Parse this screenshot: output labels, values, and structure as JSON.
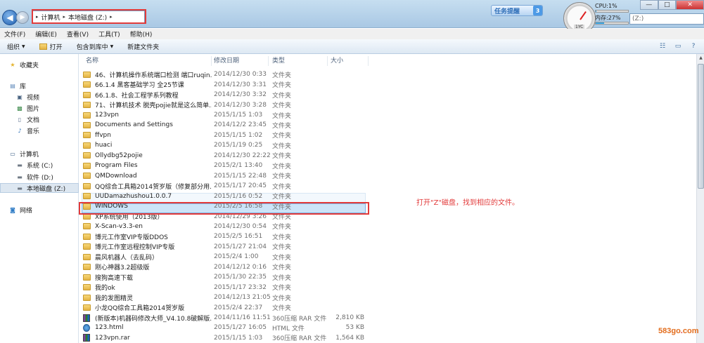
{
  "window": {
    "address": {
      "crumbs": [
        "计算机",
        "本地磁盘 (Z:)"
      ]
    },
    "search_placeholder": "(Z:)",
    "task_banner": {
      "label": "任务提醒",
      "count": "3"
    },
    "gauge_label": "1YC",
    "cpu": {
      "label": "CPU:1%",
      "percent": 1
    },
    "memory": {
      "label": "内存:27%",
      "percent": 27
    },
    "window_buttons": {
      "minimize": "—",
      "maximize": "□",
      "close": "✕"
    }
  },
  "menu": [
    "文件(F)",
    "编辑(E)",
    "查看(V)",
    "工具(T)",
    "帮助(H)"
  ],
  "toolbar": {
    "organize": "组织",
    "open": "打开",
    "include": "包含到库中",
    "new_folder": "新建文件夹"
  },
  "nav": {
    "favorites": "收藏夹",
    "libraries": "库",
    "lib_items": [
      "视频",
      "图片",
      "文档",
      "音乐"
    ],
    "computer": "计算机",
    "drives": [
      "系统 (C:)",
      "软件 (D:)",
      "本地磁盘 (Z:)"
    ],
    "network": "网络"
  },
  "columns": {
    "name": "名称",
    "date": "修改日期",
    "type": "类型",
    "size": "大小"
  },
  "files": [
    {
      "name": "46、计算机操作系统端口检测 端口ruqin...",
      "date": "2014/12/30 0:33",
      "type": "文件夹",
      "size": "",
      "kind": "folder"
    },
    {
      "name": "66.1.4 黑客基础学习 全25节课",
      "date": "2014/12/30 3:31",
      "type": "文件夹",
      "size": "",
      "kind": "folder"
    },
    {
      "name": "66.1.8、社会工程学系列教程",
      "date": "2014/12/30 3:32",
      "type": "文件夹",
      "size": "",
      "kind": "folder"
    },
    {
      "name": "71、计算机技术 脱壳pojie就是这么简单...",
      "date": "2014/12/30 3:28",
      "type": "文件夹",
      "size": "",
      "kind": "folder"
    },
    {
      "name": "123vpn",
      "date": "2015/1/15 1:03",
      "type": "文件夹",
      "size": "",
      "kind": "folder"
    },
    {
      "name": "Documents and Settings",
      "date": "2014/12/2 23:45",
      "type": "文件夹",
      "size": "",
      "kind": "folder"
    },
    {
      "name": "ffvpn",
      "date": "2015/1/15 1:02",
      "type": "文件夹",
      "size": "",
      "kind": "folder"
    },
    {
      "name": "huaci",
      "date": "2015/1/19 0:25",
      "type": "文件夹",
      "size": "",
      "kind": "folder"
    },
    {
      "name": "Ollydbg52pojie",
      "date": "2014/12/30 22:22",
      "type": "文件夹",
      "size": "",
      "kind": "folder"
    },
    {
      "name": "Program Files",
      "date": "2015/2/1 13:40",
      "type": "文件夹",
      "size": "",
      "kind": "folder"
    },
    {
      "name": "QMDownload",
      "date": "2015/1/15 22:48",
      "type": "文件夹",
      "size": "",
      "kind": "folder"
    },
    {
      "name": "QQ综合工具箱2014贺岁版（修复部分用...",
      "date": "2015/1/17 20:45",
      "type": "文件夹",
      "size": "",
      "kind": "folder"
    },
    {
      "name": "UUDamazhushou1.0.0.7",
      "date": "2015/1/16 0:52",
      "type": "文件夹",
      "size": "",
      "kind": "folder"
    },
    {
      "name": "WINDOWS",
      "date": "2015/2/5 16:58",
      "type": "文件夹",
      "size": "",
      "kind": "folder"
    },
    {
      "name": "XP系统使用（2013版）",
      "date": "2014/12/29 3:26",
      "type": "文件夹",
      "size": "",
      "kind": "folder"
    },
    {
      "name": "X-Scan-v3.3-en",
      "date": "2014/12/30 0:54",
      "type": "文件夹",
      "size": "",
      "kind": "folder"
    },
    {
      "name": "博元工作室VIP专版DDOS",
      "date": "2015/2/5 16:51",
      "type": "文件夹",
      "size": "",
      "kind": "folder"
    },
    {
      "name": "博元工作室远程控制VIP专版",
      "date": "2015/1/27 21:04",
      "type": "文件夹",
      "size": "",
      "kind": "folder"
    },
    {
      "name": "晨风机器人（去乱码）",
      "date": "2015/2/4 1:00",
      "type": "文件夹",
      "size": "",
      "kind": "folder"
    },
    {
      "name": "刚心神器3.2超级版",
      "date": "2014/12/12 0:16",
      "type": "文件夹",
      "size": "",
      "kind": "folder"
    },
    {
      "name": "搜狗高速下载",
      "date": "2015/1/30 22:35",
      "type": "文件夹",
      "size": "",
      "kind": "folder"
    },
    {
      "name": "我的ok",
      "date": "2015/1/17 23:32",
      "type": "文件夹",
      "size": "",
      "kind": "folder"
    },
    {
      "name": "我的发图精灵",
      "date": "2014/12/13 21:05",
      "type": "文件夹",
      "size": "",
      "kind": "folder"
    },
    {
      "name": "小龙QQ综合工具箱2014贺岁版",
      "date": "2015/2/4 22:37",
      "type": "文件夹",
      "size": "",
      "kind": "folder"
    },
    {
      "name": "(新版本)机器码修改大师_V4.10.8破解版...",
      "date": "2014/11/16 11:51",
      "type": "360压缩 RAR 文件",
      "size": "2,810 KB",
      "kind": "rar"
    },
    {
      "name": "123.html",
      "date": "2015/1/27 16:05",
      "type": "HTML 文件",
      "size": "53 KB",
      "kind": "html"
    },
    {
      "name": "123vpn.rar",
      "date": "2015/1/15 1:03",
      "type": "360压缩 RAR 文件",
      "size": "1,564 KB",
      "kind": "rar"
    }
  ],
  "annotation": "打开\"Z\"磁盘，找到相应的文件。",
  "watermark": {
    "text": "583go",
    "dot": ".",
    "tld": "com"
  }
}
